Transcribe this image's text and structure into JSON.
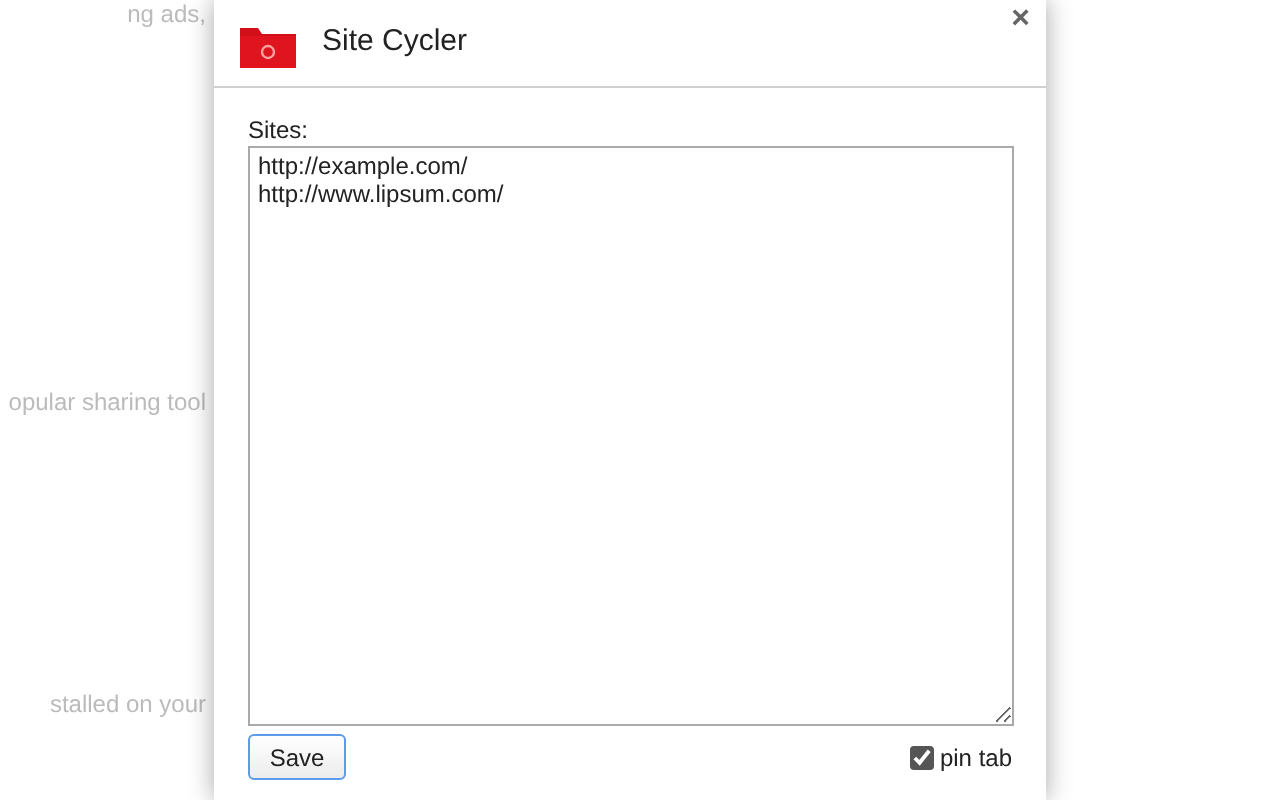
{
  "background_page": {
    "lines": [
      "ng ads,",
      "opular sharing tool",
      "stalled on your"
    ]
  },
  "dialog": {
    "title": "Site Cycler",
    "close": "×",
    "sites_label": "Sites:",
    "sites_value": "http://example.com/\nhttp://www.lipsum.com/",
    "save_button": "Save",
    "pin_tab": {
      "label": "pin tab",
      "checked": true
    }
  }
}
